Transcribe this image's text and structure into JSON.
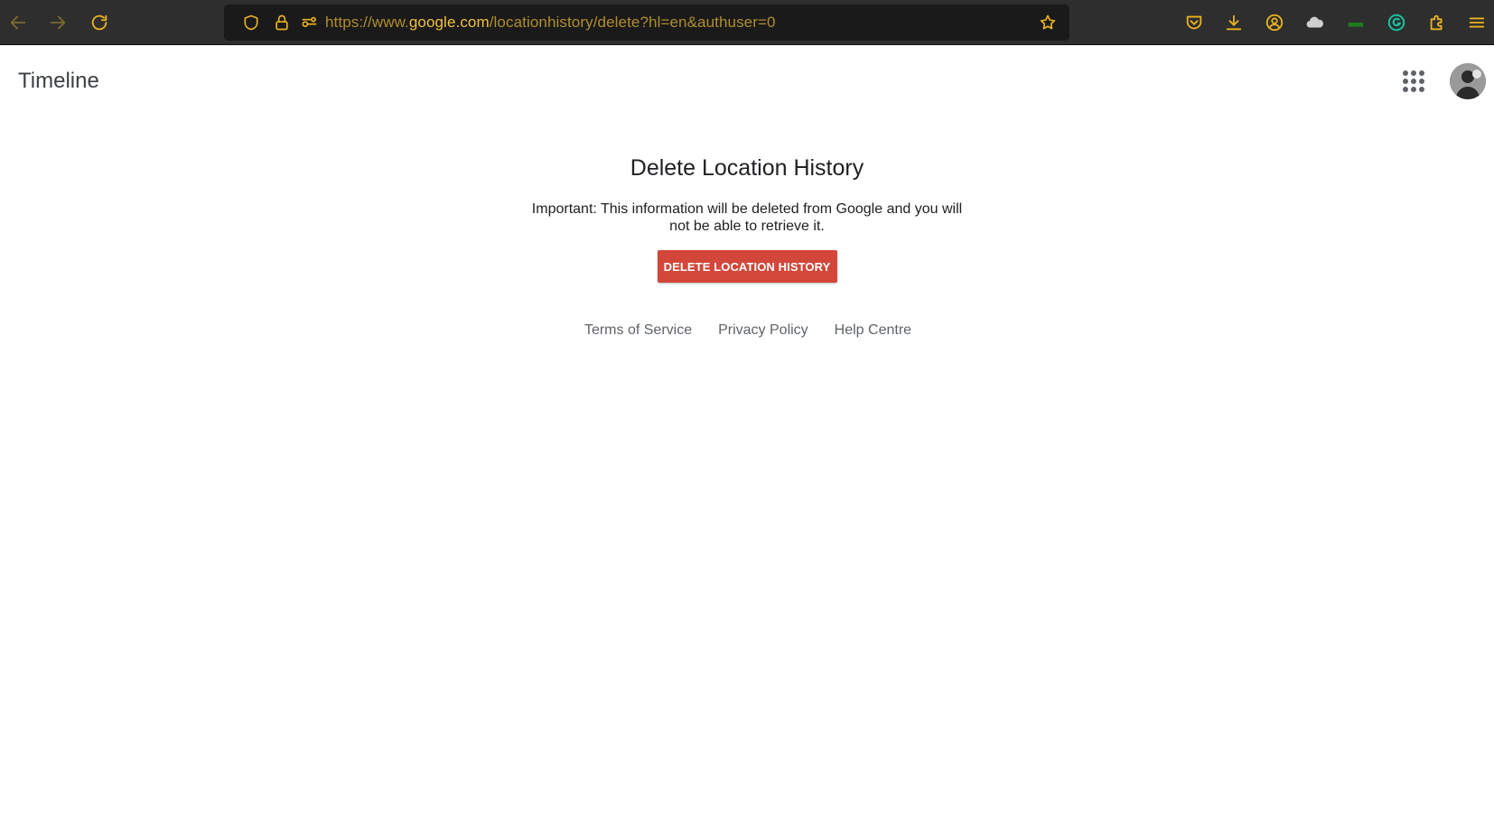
{
  "browser": {
    "url_prefix": "https://www.",
    "url_host": "google.com",
    "url_path": "/locationhistory/delete?hl=en&authuser=0",
    "accent_color": "#e8b21f",
    "icons": {
      "back": "arrow-left-icon",
      "forward": "arrow-right-icon",
      "reload": "reload-icon",
      "tracking": "shield-icon",
      "lock": "lock-icon",
      "permissions": "permissions-icon",
      "bookmark": "star-icon",
      "pocket": "pocket-icon",
      "downloads": "download-icon",
      "account": "account-icon",
      "extension1": "cloud-extension-icon",
      "extension2": "green-extension-icon",
      "grammarly": "grammarly-icon",
      "extensions": "puzzle-icon",
      "menu": "hamburger-menu-icon"
    }
  },
  "header": {
    "title": "Timeline"
  },
  "main": {
    "title": "Delete Location History",
    "warning": "Important: This information will be deleted from Google and you will not be able to retrieve it.",
    "delete_button": "DELETE LOCATION HISTORY",
    "button_color": "#d2473a"
  },
  "footer": {
    "links": [
      "Terms of Service",
      "Privacy Policy",
      "Help Centre"
    ]
  }
}
